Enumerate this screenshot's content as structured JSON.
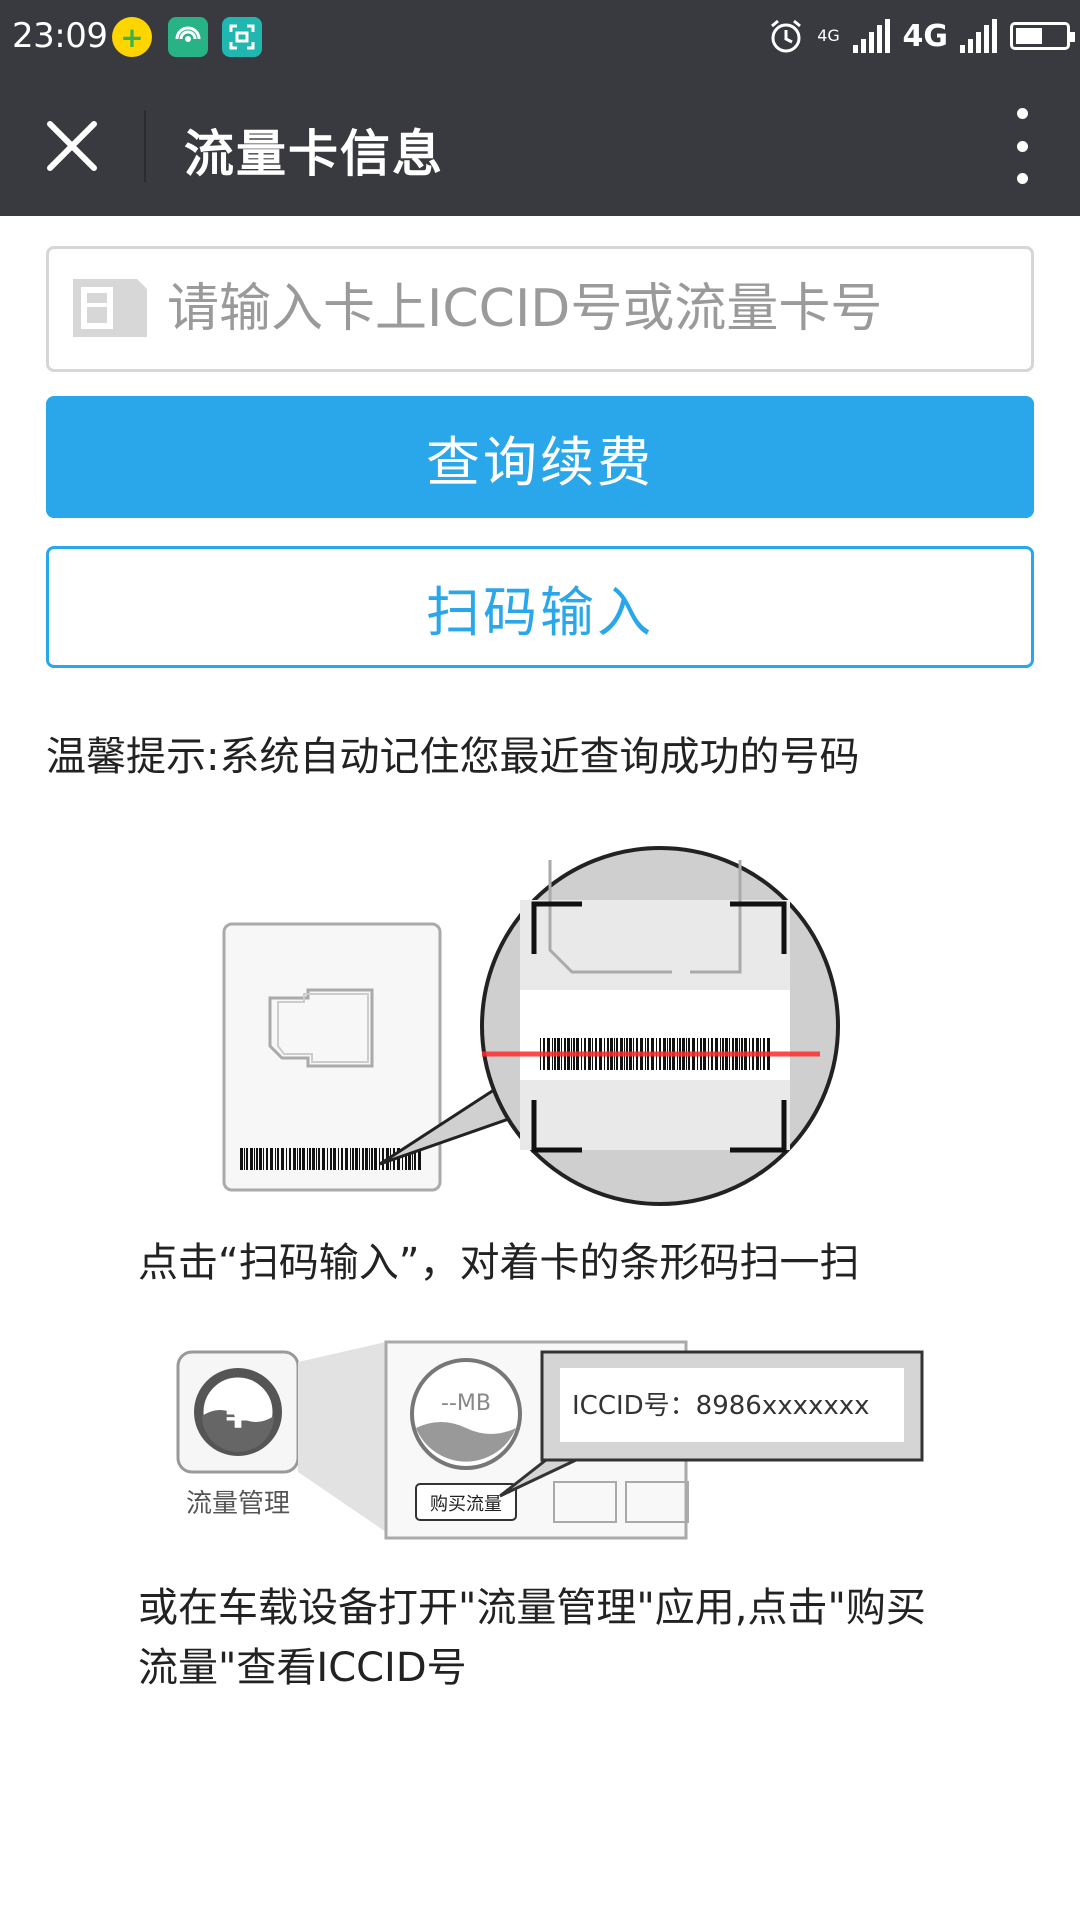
{
  "status_bar": {
    "time": "23:09",
    "network_small": "4G",
    "network": "4G",
    "battery_level": 0.55,
    "icons": [
      "plus-app-icon",
      "hotspot-icon",
      "scanner-app-icon",
      "alarm-icon",
      "signal-icon",
      "battery-icon"
    ]
  },
  "header": {
    "title": "流量卡信息",
    "close_icon": "close-icon",
    "more_icon": "more-vertical-icon"
  },
  "search": {
    "placeholder": "请输入卡上ICCID号或流量卡号",
    "value": ""
  },
  "buttons": {
    "query": "查询续费",
    "scan": "扫码输入"
  },
  "colors": {
    "header_bg": "#393a3f",
    "accent": "#29a7ea"
  },
  "tip": "温馨提示:系统自动记住您最近查询成功的号码",
  "illustration1": {
    "caption": "点击“扫码输入”，对着卡的条形码扫一扫"
  },
  "illustration2": {
    "app_name": "流量管理",
    "app_symbol": "¥",
    "data_label": "--MB",
    "buy_label": "购买流量",
    "popup_text": "ICCID号：8986xxxxxxx",
    "caption": "或在车载设备打开\"流量管理\"应用,点击\"购买流量\"查看ICCID号"
  }
}
